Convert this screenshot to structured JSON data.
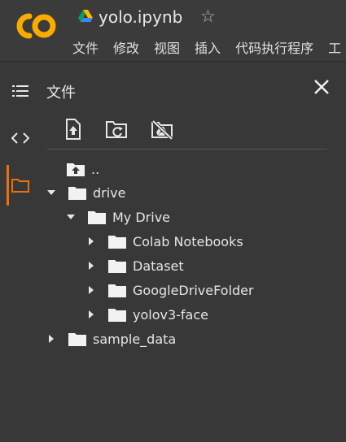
{
  "app": {
    "title": "yolo.ipynb",
    "logo_text": "CO",
    "menu": [
      "文件",
      "修改",
      "视图",
      "插入",
      "代码执行程序",
      "工"
    ]
  },
  "panel": {
    "title": "文件",
    "tools": [
      "upload-icon",
      "refresh-folder-icon",
      "unmount-drive-icon"
    ],
    "tree": [
      {
        "label": "..",
        "icon": "parent-folder-icon",
        "level": 0,
        "expanded": null
      },
      {
        "label": "drive",
        "icon": "folder-icon",
        "level": 0,
        "expanded": true
      },
      {
        "label": "My Drive",
        "icon": "folder-icon",
        "level": 1,
        "expanded": true
      },
      {
        "label": "Colab Notebooks",
        "icon": "folder-icon",
        "level": 2,
        "expanded": false
      },
      {
        "label": "Dataset",
        "icon": "folder-icon",
        "level": 2,
        "expanded": false
      },
      {
        "label": "GoogleDriveFolder",
        "icon": "folder-icon",
        "level": 2,
        "expanded": false
      },
      {
        "label": "yolov3-face",
        "icon": "folder-icon",
        "level": 2,
        "expanded": false
      },
      {
        "label": "sample_data",
        "icon": "folder-icon",
        "level": 0,
        "expanded": false
      }
    ]
  },
  "colors": {
    "accent": "#e8710a",
    "logo_orange": "#f9ab00",
    "background": "#383838"
  }
}
